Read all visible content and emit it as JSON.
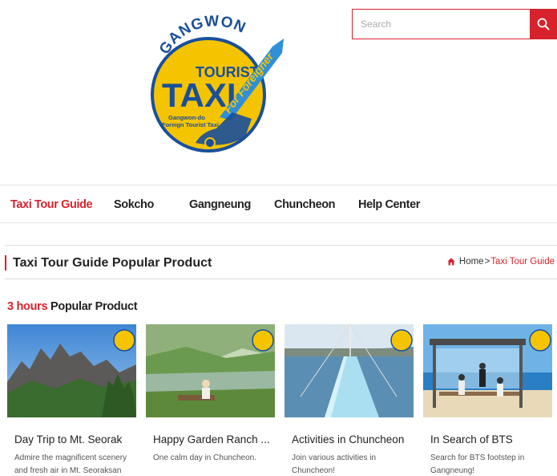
{
  "header": {
    "logo": {
      "top_text": "GANGWON",
      "line1": "TOURIST",
      "line2": "TAXI",
      "ribbon": "For Foreigner",
      "sub1": "Gangwon-do",
      "sub2": "Foreign Tourist Taxi"
    },
    "search": {
      "placeholder": "Search",
      "button_icon": "search-icon"
    }
  },
  "nav": {
    "items": [
      {
        "label": "Taxi Tour Guide",
        "active": true
      },
      {
        "label": "Sokcho",
        "active": false
      },
      {
        "label": "Gangneung",
        "active": false
      },
      {
        "label": "Chuncheon",
        "active": false
      },
      {
        "label": "Help Center",
        "active": false
      }
    ]
  },
  "page": {
    "title": "Taxi Tour Guide Popular Product",
    "breadcrumb": {
      "home_icon": "home-icon",
      "home": "Home",
      "separator": ">",
      "current": "Taxi Tour Guide"
    }
  },
  "section": {
    "title_accent": "3 hours",
    "title_rest": " Popular Product"
  },
  "products": [
    {
      "title": "Day Trip to Mt. Seorak",
      "desc": "Admire the magnificent scenery and fresh air in Mt. Seoraksan"
    },
    {
      "title": "Happy Garden Ranch ...",
      "desc": "One calm day in Chuncheon."
    },
    {
      "title": "Activities in Chuncheon",
      "desc": "Join various activities in Chuncheon!"
    },
    {
      "title": "In Search of BTS",
      "desc": "Search for BTS footstep in Gangneung!"
    }
  ],
  "colors": {
    "accent": "#d6222b",
    "logo_yellow": "#f4c400",
    "logo_blue": "#1a4f9c",
    "ribbon_blue": "#2f8fd8"
  }
}
